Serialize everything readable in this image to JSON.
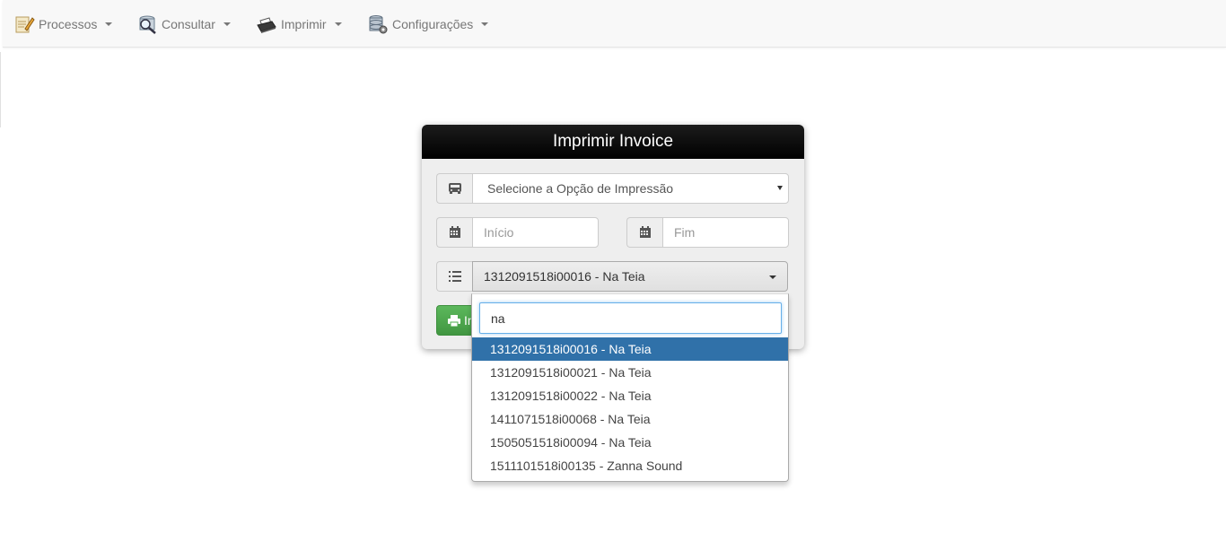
{
  "navbar": {
    "items": [
      {
        "label": "Processos",
        "icon": "notepad-pencil-icon"
      },
      {
        "label": "Consultar",
        "icon": "magnifier-database-icon"
      },
      {
        "label": "Imprimir",
        "icon": "printer-icon"
      },
      {
        "label": "Configurações",
        "icon": "database-gear-icon"
      }
    ]
  },
  "panel": {
    "title": "Imprimir Invoice",
    "print_option": {
      "icon": "bus-icon",
      "selected": "Selecione a Opção de Impressão"
    },
    "start_date": {
      "icon": "calendar-icon",
      "placeholder": "Início"
    },
    "end_date": {
      "icon": "calendar-icon",
      "placeholder": "Fim"
    },
    "invoice_select": {
      "icon": "list-icon",
      "selected": "1312091518i00016 - Na Teia"
    },
    "print_button": {
      "icon": "print-icon",
      "label": "Imprimir"
    }
  },
  "dropdown": {
    "search_value": "na",
    "results": [
      "1312091518i00016 - Na Teia",
      "1312091518i00021 - Na Teia",
      "1312091518i00022 - Na Teia",
      "1411071518i00068 - Na Teia",
      "1505051518i00094 - Na Teia",
      "1511101518i00135 - Zanna Sound"
    ],
    "active_index": 0
  },
  "colors": {
    "header_bg": "#000000",
    "highlight": "#3071a9",
    "button_green": "#5cb85c",
    "navbar_bg": "#f8f8f8"
  }
}
